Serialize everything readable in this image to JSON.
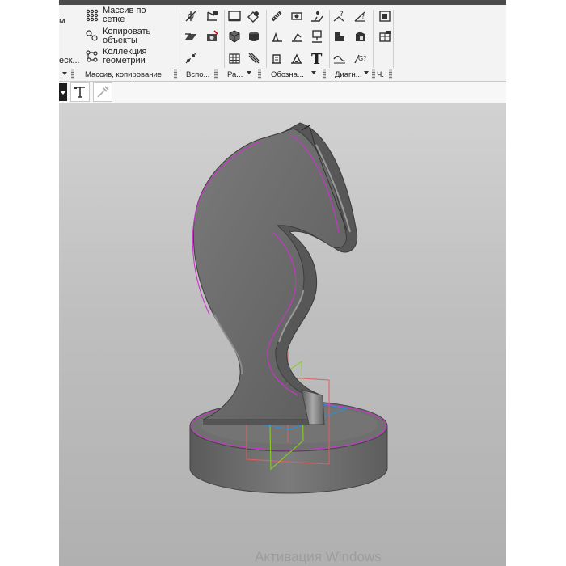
{
  "ribbon": {
    "cut_left_1": "м",
    "cut_left_2": "еск...",
    "tools": {
      "grid_array": "Массив по\nсетке",
      "copy_objects": "Копировать\nобъекты",
      "geometry_collection": "Коллекция\nгеометрии"
    }
  },
  "groups": {
    "array_copy": "Массив, копирование",
    "aux": "Вспо...",
    "sections": "Ра...",
    "designations": "Обозна...",
    "diagnostics": "Диагн...",
    "last": "Ч."
  },
  "icons": {
    "tool_model_icon": "T-symbol",
    "pipette_icon": "pipette"
  },
  "colors": {
    "viewport_top": "#d2d2d2",
    "model_fill": "#6b6b6b",
    "edge_highlight": "#cc33cc",
    "plane_red": "#e06060",
    "plane_green": "#88cc22",
    "axis_blue": "#2a8fe0"
  },
  "watermark": "Активация Windows"
}
